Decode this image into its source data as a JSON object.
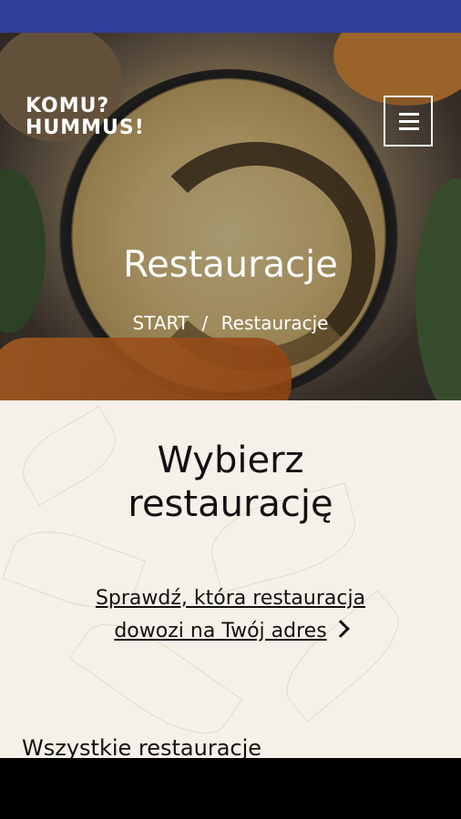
{
  "logo": {
    "line1": "KOMU?",
    "line2": "HUMMUS!"
  },
  "menu": {
    "icon": "hamburger-menu-icon"
  },
  "hero": {
    "title": "Restauracje",
    "breadcrumb": {
      "home": "START",
      "separator": "/",
      "current": "Restauracje"
    }
  },
  "main": {
    "heading_line1": "Wybierz",
    "heading_line2": "restaurację",
    "delivery_link_line1": "Sprawdź, która restauracja",
    "delivery_link_line2": "dowozi na Twój adres",
    "all_restaurants_heading": "Wszystkie restauracje"
  },
  "colors": {
    "status_bar": "#2e3f9a",
    "content_bg": "#f5f1e8",
    "text": "#111111"
  }
}
